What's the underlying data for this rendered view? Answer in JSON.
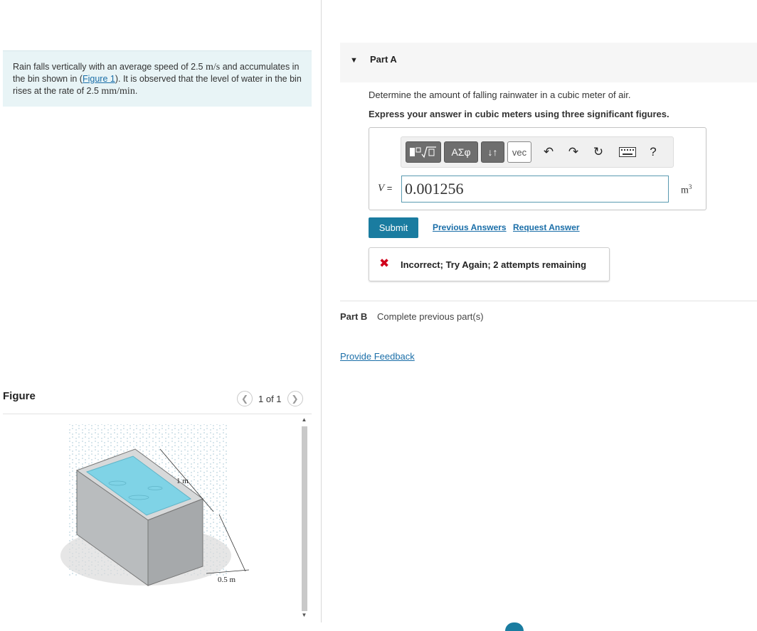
{
  "problem": {
    "text_1": "Rain falls vertically with an average speed of 2.5 ",
    "speed_unit": "m/s",
    "text_2": " and accumulates in the bin shown in (",
    "figure_link": "Figure 1",
    "text_3": "). It is observed that the level of water in the bin rises at the rate of 2.5 ",
    "rate_unit": "mm/min",
    "text_4": "."
  },
  "figure": {
    "title": "Figure",
    "pager_text": "1 of 1",
    "prev_icon": "chevron-left-icon",
    "next_icon": "chevron-right-icon",
    "label_length": "1 m",
    "label_width": "0.5 m",
    "colors": {
      "water": "#7fd3e6",
      "bin": "#c4c7c9"
    }
  },
  "part_a": {
    "label": "Part A",
    "question": "Determine the amount of falling rainwater in a cubic meter of air.",
    "instruction": "Express your answer in cubic meters using three significant figures.",
    "toolbar": {
      "templates": "templates-icon",
      "greek": "ΑΣφ",
      "arrows": "↓↑",
      "vec": "vec",
      "undo": "undo-icon",
      "redo": "redo-icon",
      "reset": "reset-icon",
      "keyboard": "keyboard-icon",
      "help": "?"
    },
    "variable": "V",
    "equals": "=",
    "answer_value": "0.001256",
    "unit": "m",
    "unit_exp": "3",
    "submit_label": "Submit",
    "previous_answers": "Previous Answers",
    "request_answer": "Request Answer",
    "feedback": "Incorrect; Try Again; 2 attempts remaining"
  },
  "part_b": {
    "label": "Part B",
    "status": "Complete previous part(s)"
  },
  "provide_feedback": "Provide Feedback",
  "colors": {
    "accent": "#1a7ca0",
    "link": "#1a6ea8",
    "error": "#d0021b",
    "problem_bg": "#e8f4f6"
  }
}
